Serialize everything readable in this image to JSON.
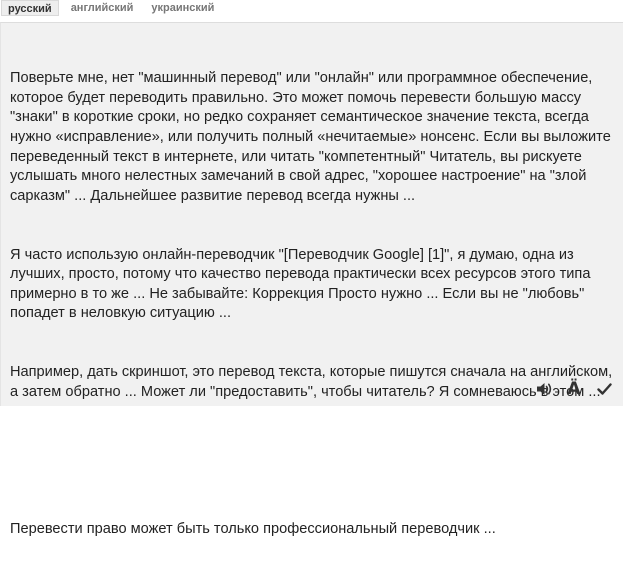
{
  "language_tabs": [
    {
      "label": "русский",
      "active": true
    },
    {
      "label": "английский",
      "active": false
    },
    {
      "label": "украинский",
      "active": false
    }
  ],
  "translation": {
    "paragraphs": [
      "Поверьте мне, нет \"машинный перевод\" или \"онлайн\" или программное обеспечение, которое будет переводить правильно. Это может помочь перевести большую массу \"знаки\" в короткие сроки, но редко сохраняет семантическое значение текста, всегда нужно «исправление», или получить полный «нечитаемые» нонсенс. Если вы выложите переведенный текст в интернете, или читать \"компетентный\" Читатель, вы рискуете услышать много нелестных замечаний в свой адрес, \"хорошее настроение\" на \"злой сарказм\" ... Дальнейшее развитие перевод всегда нужны ...",
      "Я часто использую онлайн-переводчик \"[Переводчик Google] [1]\", я думаю, одна из лучших, просто, потому что качество перевода практически всех ресурсов этого типа примерно в то же ... Не забывайте: Коррекция Просто нужно ... Если вы не \"любовь\" попадет в неловкую ситуацию ...",
      "Например, дать скриншот, это перевод текста, которые пишутся сначала на английском, а затем обратно ... Может ли \"предоставить\", чтобы читатель? Я сомневаюсь в этом ..."
    ],
    "final_line": "Перевести право может быть только профессиональный переводчик ..."
  },
  "toolbar": {
    "listen_icon": "speaker-icon",
    "transliteration_glyph": "Ä",
    "confirm_icon": "checkmark-icon"
  }
}
